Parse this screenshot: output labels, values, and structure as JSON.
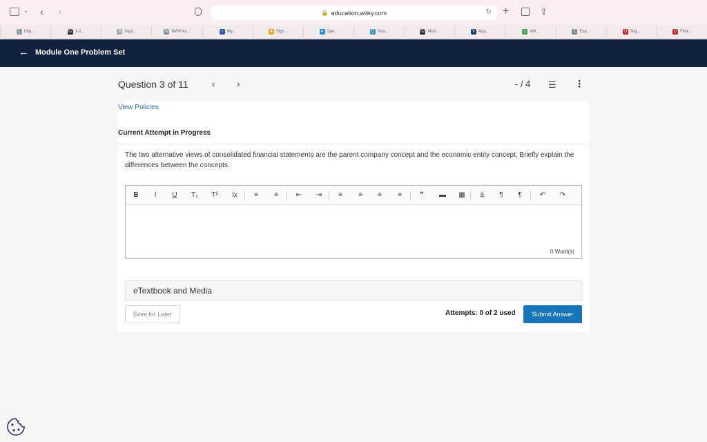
{
  "browser": {
    "url": "education.wiley.com",
    "bookmarks": [
      {
        "label": "http...",
        "fav": "L",
        "color": "#8a9aa8"
      },
      {
        "label": "1-2...",
        "fav": "BZ",
        "color": "#1e1e1e"
      },
      {
        "label": "Digit...",
        "fav": "B",
        "color": "#9aa4ad"
      },
      {
        "label": "NWP As...",
        "fav": "W",
        "color": "#7d8a96"
      },
      {
        "label": "My...",
        "fav": "~",
        "color": "#2a5fa8"
      },
      {
        "label": "Sign...",
        "fav": "■",
        "color": "#e8a317"
      },
      {
        "label": "Spe...",
        "fav": "●",
        "color": "#1c8fe0"
      },
      {
        "label": "Sca...",
        "fav": "E",
        "color": "#3a8fd8"
      },
      {
        "label": "Mod...",
        "fav": "BZ",
        "color": "#1e1e1e"
      },
      {
        "label": "App...",
        "fav": "V",
        "color": "#1d3c6e"
      },
      {
        "label": "VM...",
        "fav": "▭",
        "color": "#3aa84a"
      },
      {
        "label": "Exp...",
        "fav": "C",
        "color": "#7c8893"
      },
      {
        "label": "Nig...",
        "fav": "U",
        "color": "#c0262d"
      },
      {
        "label": "Fina...",
        "fav": "U",
        "color": "#c0262d"
      }
    ]
  },
  "nav": {
    "title": "Module One Problem Set"
  },
  "question": {
    "title": "Question 3 of 11",
    "score": "- / 4",
    "policies_link": "View Policies",
    "attempt_status": "Current Attempt in Progress",
    "text": "The two alternative views of consolidated financial statements are the parent company concept and the economic entity concept. Briefly explain the differences between the concepts.",
    "word_count": "0 Word(s)",
    "etextbook": "eTextbook and Media",
    "save_label": "Save for Later",
    "attempts": "Attempts: 0 of 2 used",
    "submit_label": "Submit Answer"
  },
  "editor_tools": [
    {
      "name": "bold-button",
      "glyph": "B"
    },
    {
      "name": "italic-button",
      "glyph": "I"
    },
    {
      "name": "underline-button",
      "glyph": "U"
    },
    {
      "name": "subscript-button",
      "glyph": "T₂"
    },
    {
      "name": "superscript-button",
      "glyph": "T²"
    },
    {
      "name": "clear-format-button",
      "glyph": "Ix"
    },
    {
      "name": "bullet-list-button",
      "glyph": "≡"
    },
    {
      "name": "numbered-list-button",
      "glyph": "≡"
    },
    {
      "name": "outdent-button",
      "glyph": "⇤"
    },
    {
      "name": "indent-button",
      "glyph": "⇥"
    },
    {
      "name": "align-left-button",
      "glyph": "≡"
    },
    {
      "name": "align-center-button",
      "glyph": "≡"
    },
    {
      "name": "align-right-button",
      "glyph": "≡"
    },
    {
      "name": "justify-button",
      "glyph": "≡"
    },
    {
      "name": "blockquote-button",
      "glyph": "❞"
    },
    {
      "name": "horizontal-rule-button",
      "glyph": "▬"
    },
    {
      "name": "table-button",
      "glyph": "▦"
    },
    {
      "name": "special-char-button",
      "glyph": "á"
    },
    {
      "name": "ltr-button",
      "glyph": "¶"
    },
    {
      "name": "rtl-button",
      "glyph": "¶"
    },
    {
      "name": "undo-button",
      "glyph": "↶"
    },
    {
      "name": "redo-button",
      "glyph": "↷"
    }
  ]
}
